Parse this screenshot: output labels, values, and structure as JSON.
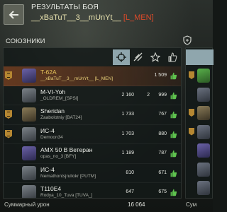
{
  "header": {
    "title": "РЕЗУЛЬТАТЫ БОЯ",
    "player_name": "__xBaTuT__3__mUnYt__",
    "player_clan": "[L_MEN]"
  },
  "allies": {
    "label": "СОЮЗНИКИ",
    "tabs": [
      {
        "name": "damage-tab",
        "active": true
      },
      {
        "name": "blocked-tab",
        "active": false
      },
      {
        "name": "experience-tab",
        "active": false
      },
      {
        "name": "likes-tab",
        "active": false
      }
    ],
    "rows": [
      {
        "tank": "T-62A",
        "player": "__xBaTuT__3__mUnYt__ [L_MEN]",
        "damage": "",
        "blocked": "",
        "exp": "1 509",
        "rank": true,
        "icon": "purple",
        "is_player": true
      },
      {
        "tank": "M-VI-Yoh",
        "player": "_OLDREM_[SPSI]",
        "damage": "2 160",
        "blocked": "2",
        "exp": "999",
        "rank": false,
        "icon": "grey",
        "is_player": false
      },
      {
        "tank": "Sheridan",
        "player": "Zaabolotniy [BAT24]",
        "damage": "1 733",
        "blocked": "",
        "exp": "767",
        "rank": true,
        "icon": "olive",
        "is_player": false
      },
      {
        "tank": "ИС-4",
        "player": "Demoon34",
        "damage": "1 703",
        "blocked": "",
        "exp": "880",
        "rank": true,
        "icon": "grey",
        "is_player": false
      },
      {
        "tank": "AMX 50 B Ветеран",
        "player": "opas_no_3 [BFY]",
        "damage": "1 189",
        "blocked": "",
        "exp": "787",
        "rank": false,
        "icon": "purple",
        "is_player": false
      },
      {
        "tank": "ИС-4",
        "player": "Nemathontsjrullokr [PUTM]",
        "damage": "810",
        "blocked": "",
        "exp": "671",
        "rank": false,
        "icon": "grey",
        "is_player": false
      },
      {
        "tank": "T110E4",
        "player": "Rodya_10_Tuva [TUVA_]",
        "damage": "647",
        "blocked": "",
        "exp": "675",
        "rank": false,
        "icon": "grey",
        "is_player": false
      }
    ],
    "footer_label": "Суммарный урон",
    "footer_value": "16 064"
  },
  "enemies": {
    "rows": [
      {
        "rank": true,
        "icon": "hl"
      },
      {
        "rank": false,
        "icon": "grey"
      },
      {
        "rank": true,
        "icon": "olive"
      },
      {
        "rank": true,
        "icon": "grey"
      },
      {
        "rank": false,
        "icon": "purple"
      },
      {
        "rank": false,
        "icon": "grey"
      },
      {
        "rank": false,
        "icon": "grey"
      }
    ],
    "footer_label": "Сум"
  },
  "colors": {
    "accent_tab": "#8fa6ad",
    "clan": "#d94a2a",
    "highlight_row": "#c45c26",
    "rank_badge": "#b58732"
  }
}
